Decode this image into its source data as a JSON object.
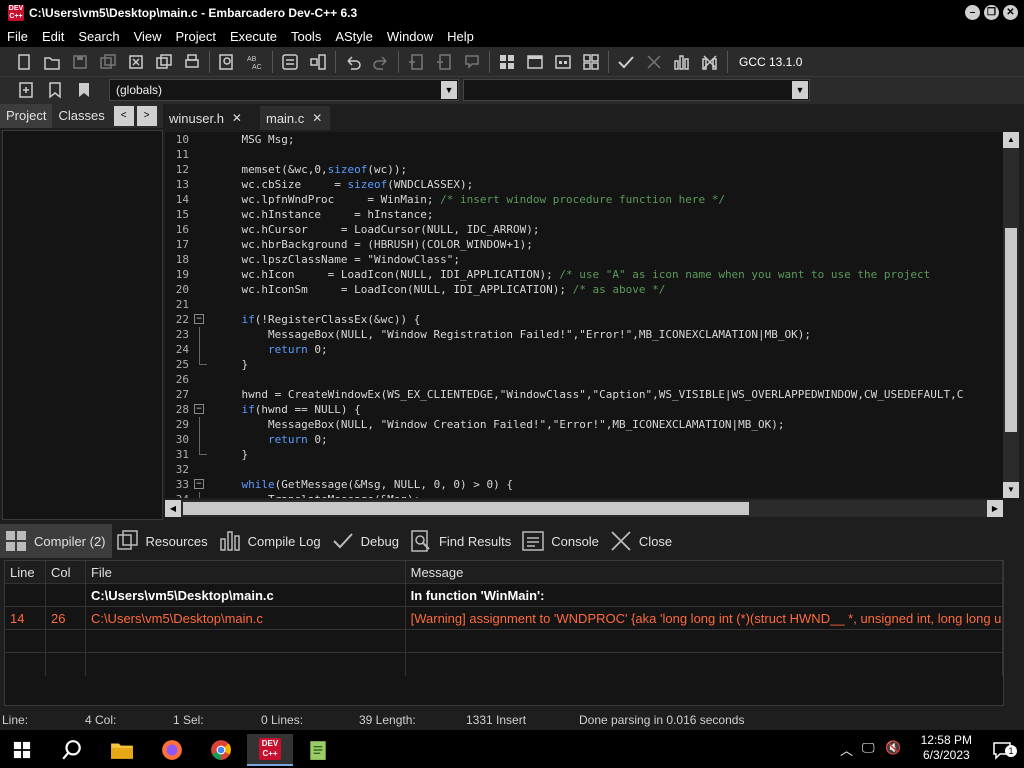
{
  "window": {
    "title": "C:\\Users\\vm5\\Desktop\\main.c - Embarcadero Dev-C++ 6.3",
    "icon_text": "DEV C++"
  },
  "menu": [
    "File",
    "Edit",
    "Search",
    "View",
    "Project",
    "Execute",
    "Tools",
    "AStyle",
    "Window",
    "Help"
  ],
  "toolbar": {
    "compiler": "GCC 13.1.0"
  },
  "toolbar2": {
    "scope_combo": "(globals)",
    "member_combo": ""
  },
  "left_panel": {
    "tabs": [
      "Project",
      "Classes"
    ],
    "nav_prev": "<",
    "nav_next": ">"
  },
  "editor_tabs": [
    {
      "label": "winuser.h",
      "close": "✕"
    },
    {
      "label": "main.c",
      "close": "✕"
    }
  ],
  "code_lines": [
    {
      "n": "10",
      "text": "\tMSG Msg;"
    },
    {
      "n": "11",
      "text": ""
    },
    {
      "n": "12",
      "text": "\tmemset(&wc,0,sizeof(wc));"
    },
    {
      "n": "13",
      "text": "\twc.cbSize\t = sizeof(WNDCLASSEX);"
    },
    {
      "n": "14",
      "text": "\twc.lpfnWndProc\t = WinMain; /* insert window procedure function here */"
    },
    {
      "n": "15",
      "text": "\twc.hInstance\t = hInstance;"
    },
    {
      "n": "16",
      "text": "\twc.hCursor\t = LoadCursor(NULL, IDC_ARROW);"
    },
    {
      "n": "17",
      "text": "\twc.hbrBackground = (HBRUSH)(COLOR_WINDOW+1);"
    },
    {
      "n": "18",
      "text": "\twc.lpszClassName = \"WindowClass\";"
    },
    {
      "n": "19",
      "text": "\twc.hIcon\t = LoadIcon(NULL, IDI_APPLICATION); /* use \"A\" as icon name when you want to use the project"
    },
    {
      "n": "20",
      "text": "\twc.hIconSm\t = LoadIcon(NULL, IDI_APPLICATION); /* as above */"
    },
    {
      "n": "21",
      "text": ""
    },
    {
      "n": "22",
      "text": "\tif(!RegisterClassEx(&wc)) {"
    },
    {
      "n": "23",
      "text": "\t\tMessageBox(NULL, \"Window Registration Failed!\",\"Error!\",MB_ICONEXCLAMATION|MB_OK);"
    },
    {
      "n": "24",
      "text": "\t\treturn 0;"
    },
    {
      "n": "25",
      "text": "\t}"
    },
    {
      "n": "26",
      "text": ""
    },
    {
      "n": "27",
      "text": "\thwnd = CreateWindowEx(WS_EX_CLIENTEDGE,\"WindowClass\",\"Caption\",WS_VISIBLE|WS_OVERLAPPEDWINDOW,CW_USEDEFAULT,C"
    },
    {
      "n": "28",
      "text": "\tif(hwnd == NULL) {"
    },
    {
      "n": "29",
      "text": "\t\tMessageBox(NULL, \"Window Creation Failed!\",\"Error!\",MB_ICONEXCLAMATION|MB_OK);"
    },
    {
      "n": "30",
      "text": "\t\treturn 0;"
    },
    {
      "n": "31",
      "text": "\t}"
    },
    {
      "n": "32",
      "text": ""
    },
    {
      "n": "33",
      "text": "\twhile(GetMessage(&Msg, NULL, 0, 0) > 0) {"
    },
    {
      "n": "34",
      "text": "\t\tTranslateMessage(&Msg);"
    }
  ],
  "bottom_tabs": [
    "Compiler (2)",
    "Resources",
    "Compile Log",
    "Debug",
    "Find Results",
    "Console",
    "Close"
  ],
  "messages": {
    "headers": [
      "Line",
      "Col",
      "File",
      "Message"
    ],
    "rows": [
      {
        "line": "",
        "col": "",
        "file": "C:\\Users\\vm5\\Desktop\\main.c",
        "message": "In function 'WinMain':"
      },
      {
        "line": "14",
        "col": "26",
        "file": "C:\\Users\\vm5\\Desktop\\main.c",
        "message": "[Warning] assignment to 'WNDPROC' {aka 'long long int (*)(struct HWND__ *, unsigned int,  long long un..."
      }
    ]
  },
  "status": {
    "line": "Line:",
    "col": "4 Col:",
    "sel": "1 Sel:",
    "lines": "0 Lines:",
    "length": "39 Length:",
    "insert": "1331 Insert",
    "parse": "Done parsing in 0.016 seconds"
  },
  "taskbar": {
    "time": "12:58 PM",
    "date": "6/3/2023",
    "notif": "1"
  },
  "colors": {
    "warning": "#ff6a3d",
    "keyword": "#5b9bff",
    "comment": "#5a9a5a"
  }
}
